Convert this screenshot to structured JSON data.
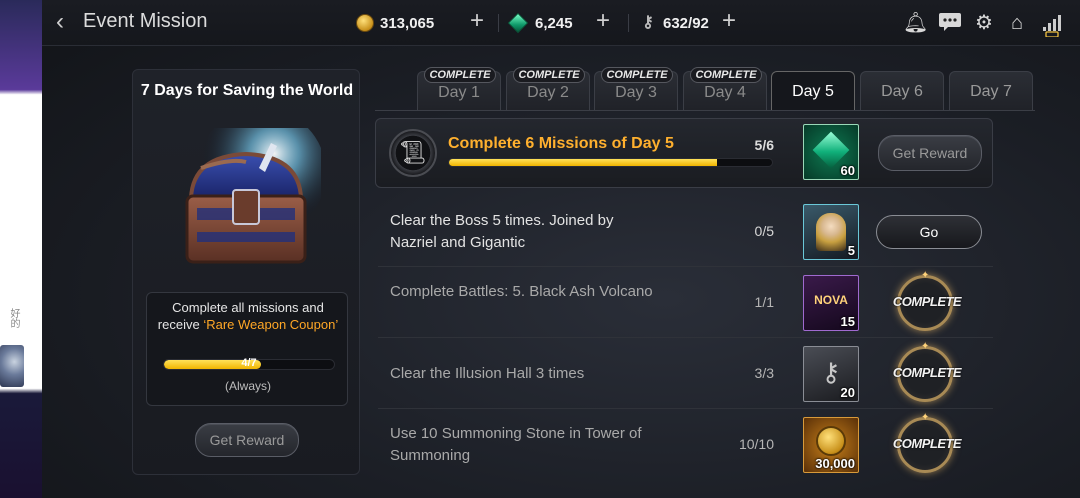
{
  "side": {
    "text": "好的"
  },
  "header": {
    "title": "Event Mission"
  },
  "resources": {
    "gold": "313,065",
    "gems": "6,245",
    "tickets": "632/92"
  },
  "left_panel": {
    "title": "7 Days for Saving the World",
    "desc_line1": "Complete all missions and",
    "desc_prefix": "receive ",
    "reward_name": "‘Rare Weapon Coupon’",
    "progress_label": "4/7",
    "progress_fraction": 0.57,
    "period": "(Always)",
    "button": "Get Reward"
  },
  "tabs": [
    {
      "label": "Day 1",
      "stamp": "COMPLETE"
    },
    {
      "label": "Day 2",
      "stamp": "COMPLETE"
    },
    {
      "label": "Day 3",
      "stamp": "COMPLETE"
    },
    {
      "label": "Day 4",
      "stamp": "COMPLETE"
    },
    {
      "label": "Day 5",
      "stamp": ""
    },
    {
      "label": "Day 6",
      "stamp": ""
    },
    {
      "label": "Day 7",
      "stamp": ""
    }
  ],
  "main_mission": {
    "text": "Complete 6 Missions of Day 5",
    "progress": "5/6",
    "progress_fraction": 0.83,
    "reward_qty": "60",
    "button": "Get Reward"
  },
  "missions": [
    {
      "text": "Clear the Boss 5 times. Joined by Nazriel and Gigantic",
      "progress": "0/5",
      "reward_qty": "5",
      "action": "Go"
    },
    {
      "text": "Complete Battles: 5. Black Ash Volcano",
      "progress": "1/1",
      "reward_qty": "15",
      "reward_label": "NOVA",
      "action": "COMPLETE"
    },
    {
      "text": "Clear the Illusion Hall 3 times",
      "progress": "3/3",
      "reward_qty": "20",
      "action": "COMPLETE"
    },
    {
      "text": "Use 10 Summoning Stone in Tower of Summoning",
      "progress": "10/10",
      "reward_qty": "30,000",
      "action": "COMPLETE"
    }
  ],
  "colors": {
    "accent": "#ffb02e",
    "progress": "#f0b400",
    "gem": "#0f9a6a"
  }
}
